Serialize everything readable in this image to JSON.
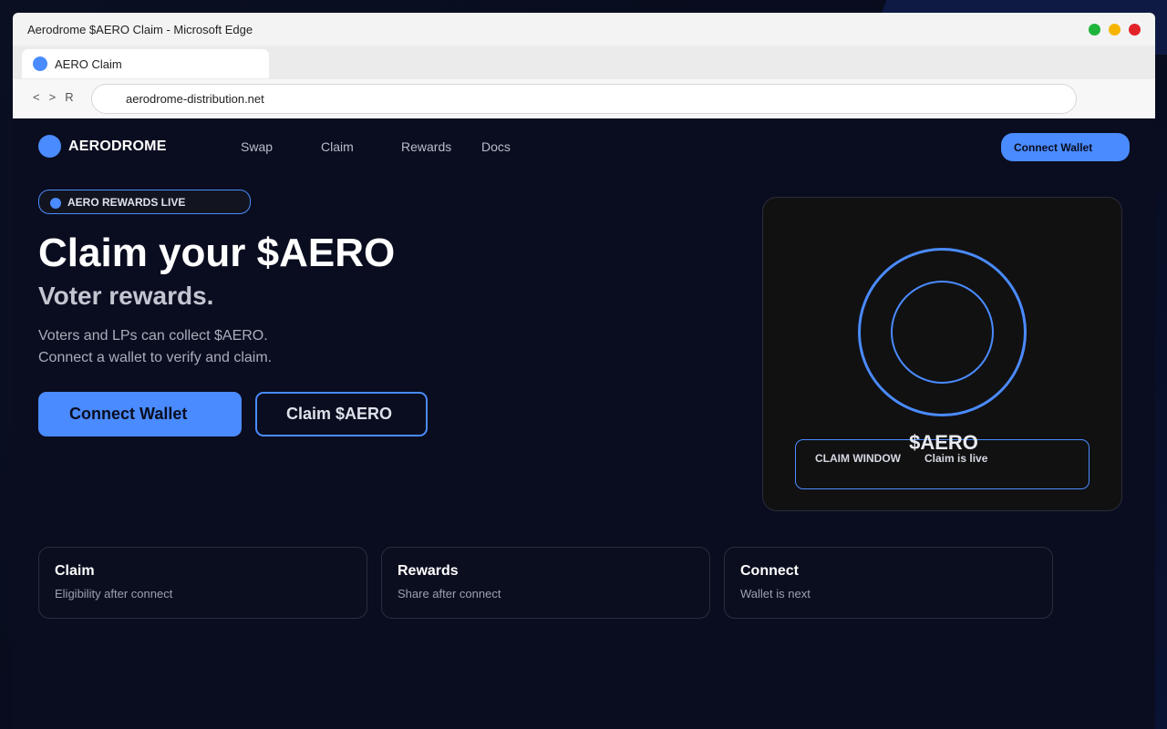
{
  "browser": {
    "window_title": "Aerodrome $AERO Claim - Microsoft Edge",
    "tab_label": "AERO Claim",
    "nav_back": "<",
    "nav_forward": ">",
    "nav_reload": "R",
    "address": "aerodrome-distribution.net"
  },
  "site": {
    "logo_text": "AERODROME",
    "nav": [
      "Swap",
      "Claim",
      "Rewards",
      "Docs"
    ],
    "header_button": "Connect Wallet"
  },
  "hero": {
    "badge": "AERO REWARDS LIVE",
    "title": "Claim your $AERO",
    "subtitle": "Voter rewards.",
    "desc_line1": "Voters and LPs can collect $AERO.",
    "desc_line2": "Connect a wallet to verify and claim.",
    "primary_button": "Connect Wallet",
    "secondary_button": "Claim $AERO"
  },
  "token_card": {
    "token": "$AERO",
    "claim_window_label": "CLAIM WINDOW",
    "claim_window_status": "Claim is live"
  },
  "info_cards": [
    {
      "title": "Claim",
      "sub": "Eligibility after connect"
    },
    {
      "title": "Rewards",
      "sub": "Share after connect"
    },
    {
      "title": "Connect",
      "sub": "Wallet is next"
    }
  ],
  "colors": {
    "accent": "#4a8bff",
    "background": "#0a0d1f"
  }
}
